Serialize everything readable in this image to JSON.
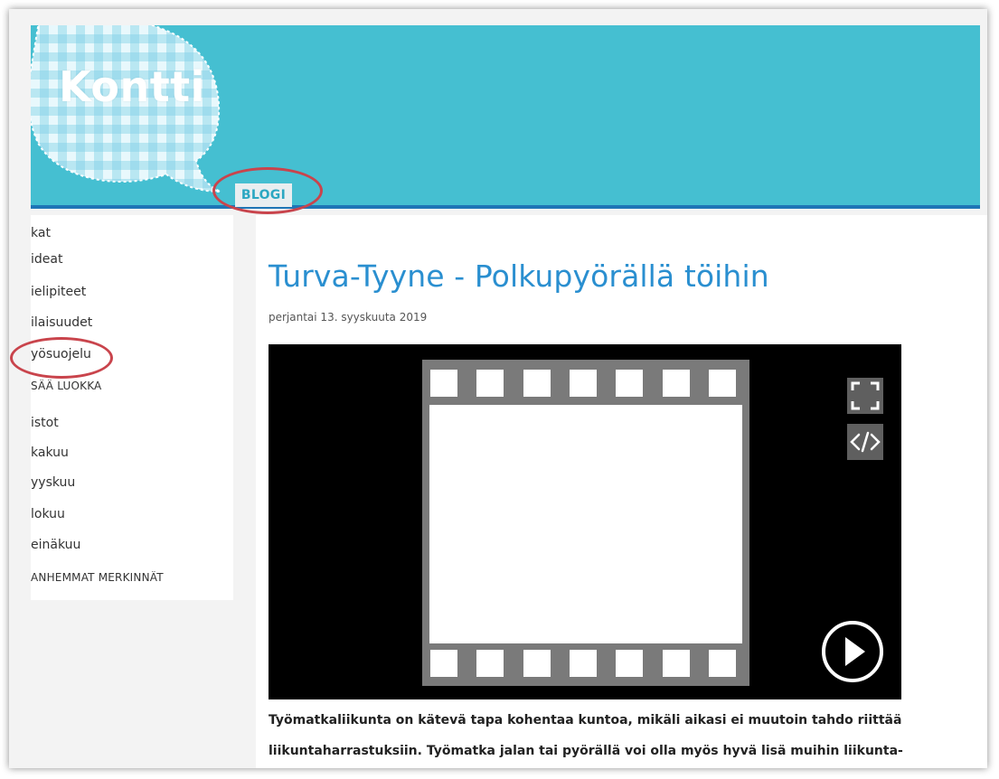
{
  "header": {
    "logo_text": "Kontti",
    "nav_tab": "BLOGI"
  },
  "sidebar": {
    "items": [
      "kat",
      "ideat",
      "ielipiteet",
      "ilaisuudet",
      "yösuojelu",
      "SÄÄ LUOKKA",
      "istot",
      "kakuu",
      "yyskuu",
      "lokuu",
      "einäkuu",
      "ANHEMMAT MERKINNÄT"
    ]
  },
  "post": {
    "title": "Turva-Tyyne - Polkupyörällä töihin",
    "date": "perjantai 13. syyskuuta 2019",
    "body_line_1": "Työmatkaliikunta on kätevä tapa kohentaa kuntoa, mikäli aikasi ei muutoin tahdo riittää",
    "body_line_2": "liikuntaharrastuksiin. Työmatka jalan tai pyörällä voi olla myös hyvä lisä muihin liikunta-"
  },
  "video": {
    "fullscreen_icon": "fullscreen-icon",
    "embed_icon": "embed-code-icon",
    "play_icon": "play-icon",
    "placeholder_icon": "film-strip-icon"
  },
  "colors": {
    "header_bg": "#45bfd1",
    "header_border": "#1e75b6",
    "title_blue": "#2a8fd0",
    "tab_text": "#2ca7c2",
    "highlight_red": "#c9444c"
  }
}
